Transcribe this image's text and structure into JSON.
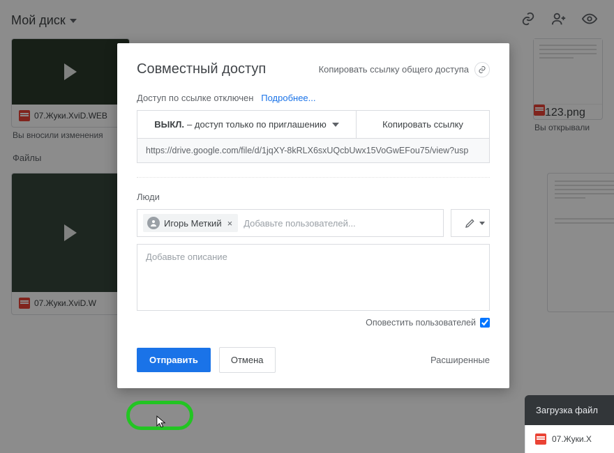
{
  "drive": {
    "title": "Мой диск",
    "cards": {
      "video1": {
        "name": "07.Жуки.XviD.WEB",
        "sub": "Вы вносили изменения"
      },
      "img1": {
        "name": "123.png",
        "sub": "Вы открывали"
      },
      "video2": {
        "name": "07.Жуки.XviD.W"
      }
    },
    "section_files": "Файлы"
  },
  "modal": {
    "title": "Совместный доступ",
    "copy_link_label": "Копировать ссылку общего доступа",
    "link_status": "Доступ по ссылке отключен",
    "learn_more": "Подробнее...",
    "mode_off": "ВЫКЛ.",
    "mode_desc": " – доступ только по приглашению",
    "copy_btn": "Копировать ссылку",
    "url": "https://drive.google.com/file/d/1jqXY-8kRLX6sxUQcbUwx15VoGwEFou75/view?usp",
    "people_label": "Люди",
    "chip_name": "Игорь Меткий",
    "add_placeholder": "Добавьте пользователей...",
    "desc_placeholder": "Добавьте описание",
    "notify_label": "Оповестить пользователей",
    "send": "Отправить",
    "cancel": "Отмена",
    "advanced": "Расширенные"
  },
  "toast": {
    "title": "Загрузка файл",
    "file": "07.Жуки.X"
  }
}
